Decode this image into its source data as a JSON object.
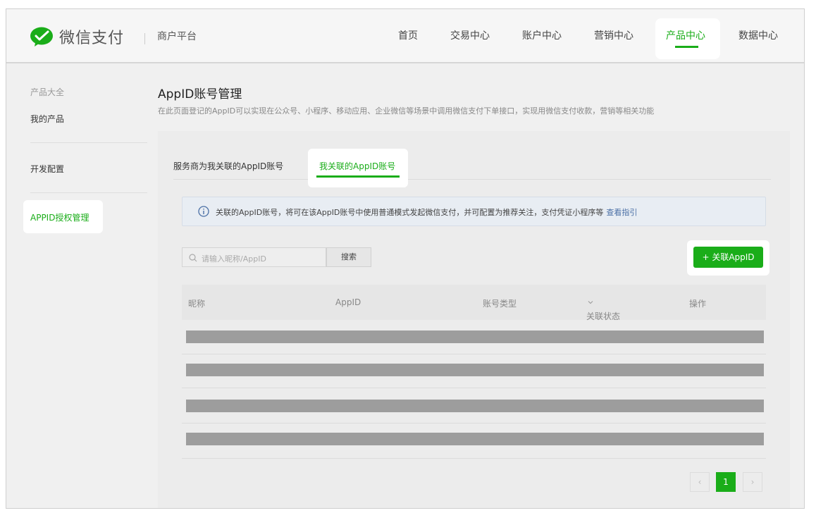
{
  "header": {
    "brand": "微信支付",
    "platform": "商户平台",
    "nav": [
      {
        "label": "首页"
      },
      {
        "label": "交易中心"
      },
      {
        "label": "账户中心"
      },
      {
        "label": "营销中心"
      },
      {
        "label": "产品中心",
        "active": true
      },
      {
        "label": "数据中心"
      }
    ],
    "brand_color": "#1aad19"
  },
  "sidebar": {
    "category": "产品大全",
    "items": [
      {
        "label": "我的产品"
      },
      {
        "label": "开发配置"
      },
      {
        "label": "APPID授权管理",
        "active": true
      }
    ]
  },
  "main": {
    "title": "AppID账号管理",
    "description": "在此页面登记的AppID可以实现在公众号、小程序、移动应用、企业微信等场景中调用微信支付下单接口，实现用微信支付收款，营销等相关功能",
    "tabs": [
      {
        "label": "服务商为我关联的AppID账号"
      },
      {
        "label": "我关联的AppID账号",
        "active": true
      }
    ],
    "notice": {
      "text": "关联的AppID账号，将可在该AppID账号中使用普通模式发起微信支付，并可配置为推荐关注，支付凭证小程序等",
      "link": "查看指引"
    },
    "search": {
      "placeholder": "请输入昵称/AppID",
      "button": "搜索"
    },
    "add_button": "+ 关联AppID",
    "table": {
      "columns": [
        "昵称",
        "AppID",
        "账号类型",
        "关联状态",
        "操作"
      ],
      "placeholder_rows": 4
    },
    "pagination": {
      "prev": "‹",
      "current": "1",
      "next": "›"
    }
  }
}
